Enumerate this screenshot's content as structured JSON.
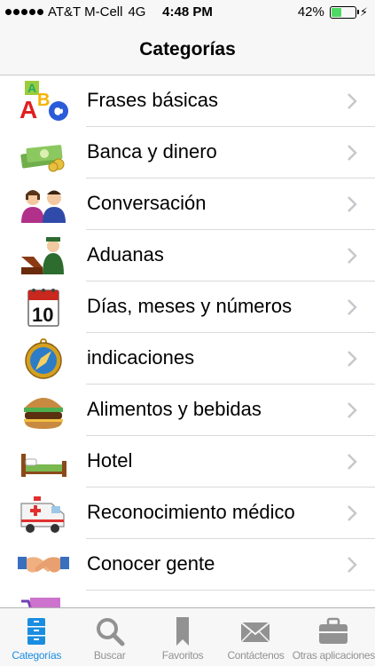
{
  "status_bar": {
    "carrier": "AT&T M-Cell",
    "network": "4G",
    "time": "4:48 PM",
    "battery_text": "42%",
    "battery_level": 0.42,
    "bolt": "⚡"
  },
  "nav": {
    "title": "Categorías"
  },
  "categories": [
    {
      "label": "Frases básicas",
      "icon": "abc-blocks-icon"
    },
    {
      "label": "Banca y dinero",
      "icon": "money-icon"
    },
    {
      "label": "Conversación",
      "icon": "people-talking-icon"
    },
    {
      "label": "Aduanas",
      "icon": "customs-officer-icon"
    },
    {
      "label": "Días, meses y números",
      "icon": "calendar-icon"
    },
    {
      "label": "indicaciones",
      "icon": "compass-icon"
    },
    {
      "label": "Alimentos y bebidas",
      "icon": "burger-icon"
    },
    {
      "label": "Hotel",
      "icon": "bed-icon"
    },
    {
      "label": "Reconocimiento médico",
      "icon": "ambulance-icon"
    },
    {
      "label": "Conocer gente",
      "icon": "handshake-icon"
    },
    {
      "label": "",
      "icon": "shopping-cart-icon"
    }
  ],
  "tabs": [
    {
      "label": "Categorías",
      "icon": "categories-icon",
      "active": true
    },
    {
      "label": "Buscar",
      "icon": "search-icon",
      "active": false
    },
    {
      "label": "Favoritos",
      "icon": "bookmark-icon",
      "active": false
    },
    {
      "label": "Contáctenos",
      "icon": "envelope-icon",
      "active": false
    },
    {
      "label": "Otras aplicaciones",
      "icon": "briefcase-icon",
      "active": false
    }
  ],
  "colors": {
    "accent": "#1a8de0",
    "inactive": "#929292",
    "battery": "#4cd964"
  }
}
